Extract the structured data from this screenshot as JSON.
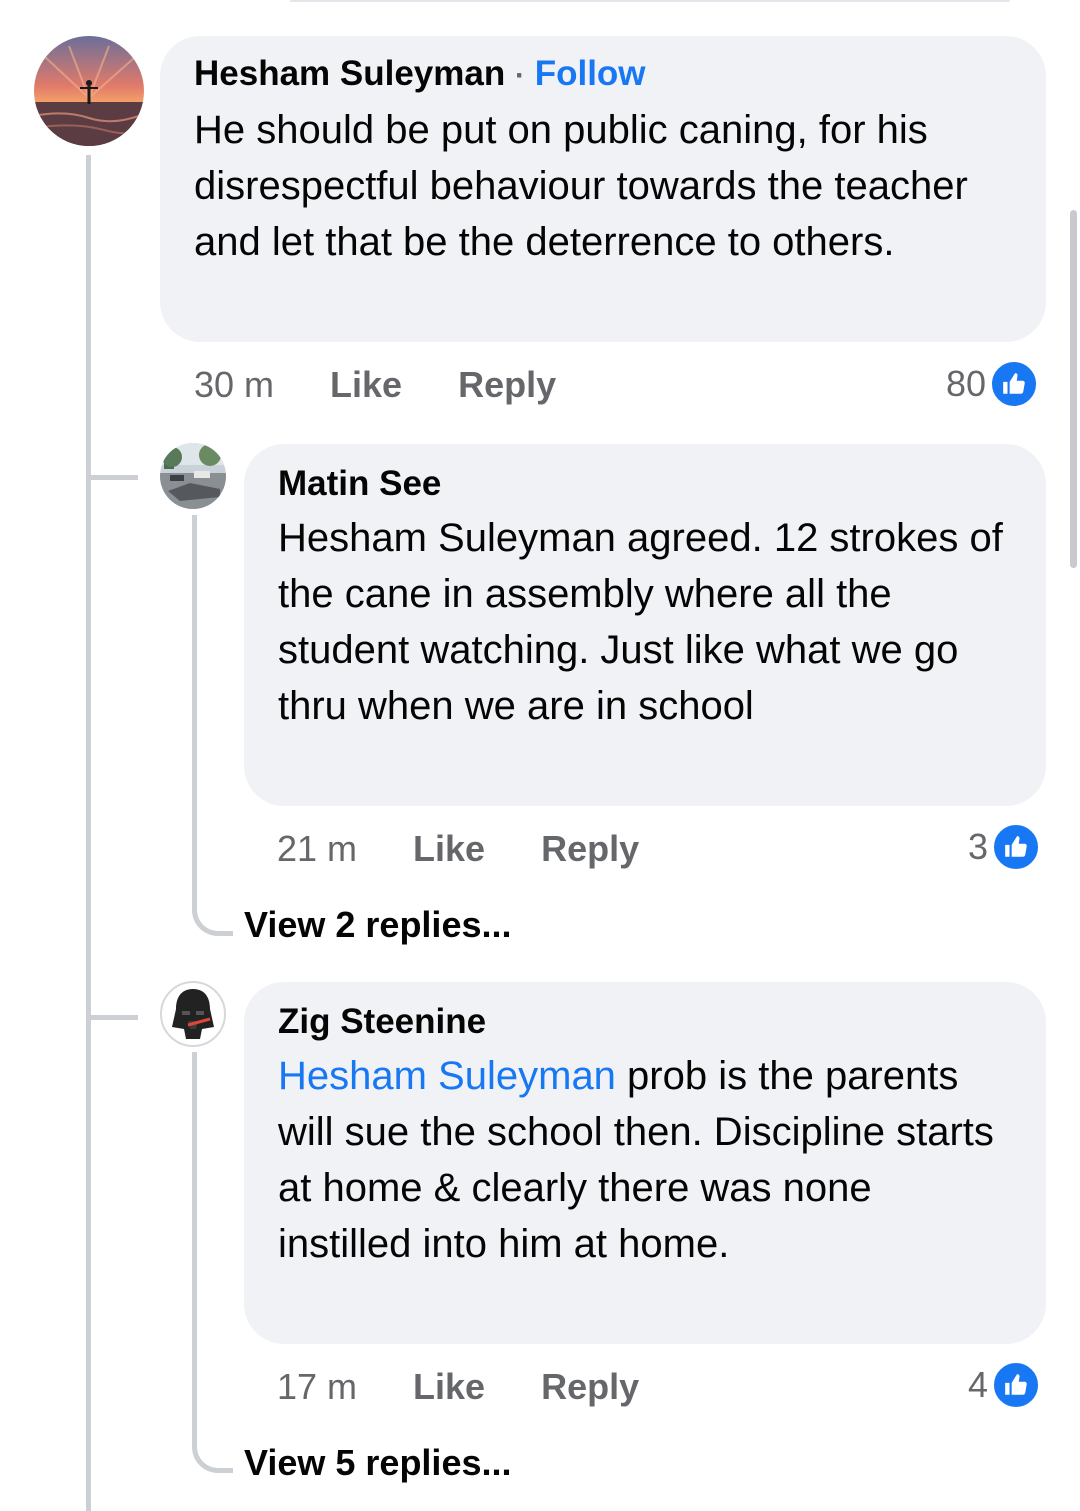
{
  "comments": [
    {
      "author": "Hesham Suleyman",
      "separator": "·",
      "follow_label": "Follow",
      "text": "He should be put on public caning, for his disrespectful behaviour towards the teacher and let that be the deterrence to others.",
      "time": "30 m",
      "like_label": "Like",
      "reply_label": "Reply",
      "reactions": "80",
      "avatar_icon": "sunset-photo-avatar"
    },
    {
      "author": "Matin See",
      "text": "Hesham Suleyman agreed. 12 strokes of the cane in assembly where all the student watching. Just like what we go thru when we are in school",
      "time": "21 m",
      "like_label": "Like",
      "reply_label": "Reply",
      "reactions": "3",
      "view_replies": "View 2 replies...",
      "avatar_icon": "street-photo-avatar"
    },
    {
      "author": "Zig Steenine",
      "mention": "Hesham Suleyman",
      "text": " prob is the parents will sue the school then. Discipline starts at home & clearly there was none instilled into him at home.",
      "time": "17 m",
      "like_label": "Like",
      "reply_label": "Reply",
      "reactions": "4",
      "view_replies": "View 5 replies...",
      "avatar_icon": "darth-vader-avatar"
    }
  ],
  "colors": {
    "accent": "#1877f2",
    "bubble": "#f0f2f5",
    "secondary_text": "#65676b",
    "thread_line": "#ccd0d5"
  }
}
